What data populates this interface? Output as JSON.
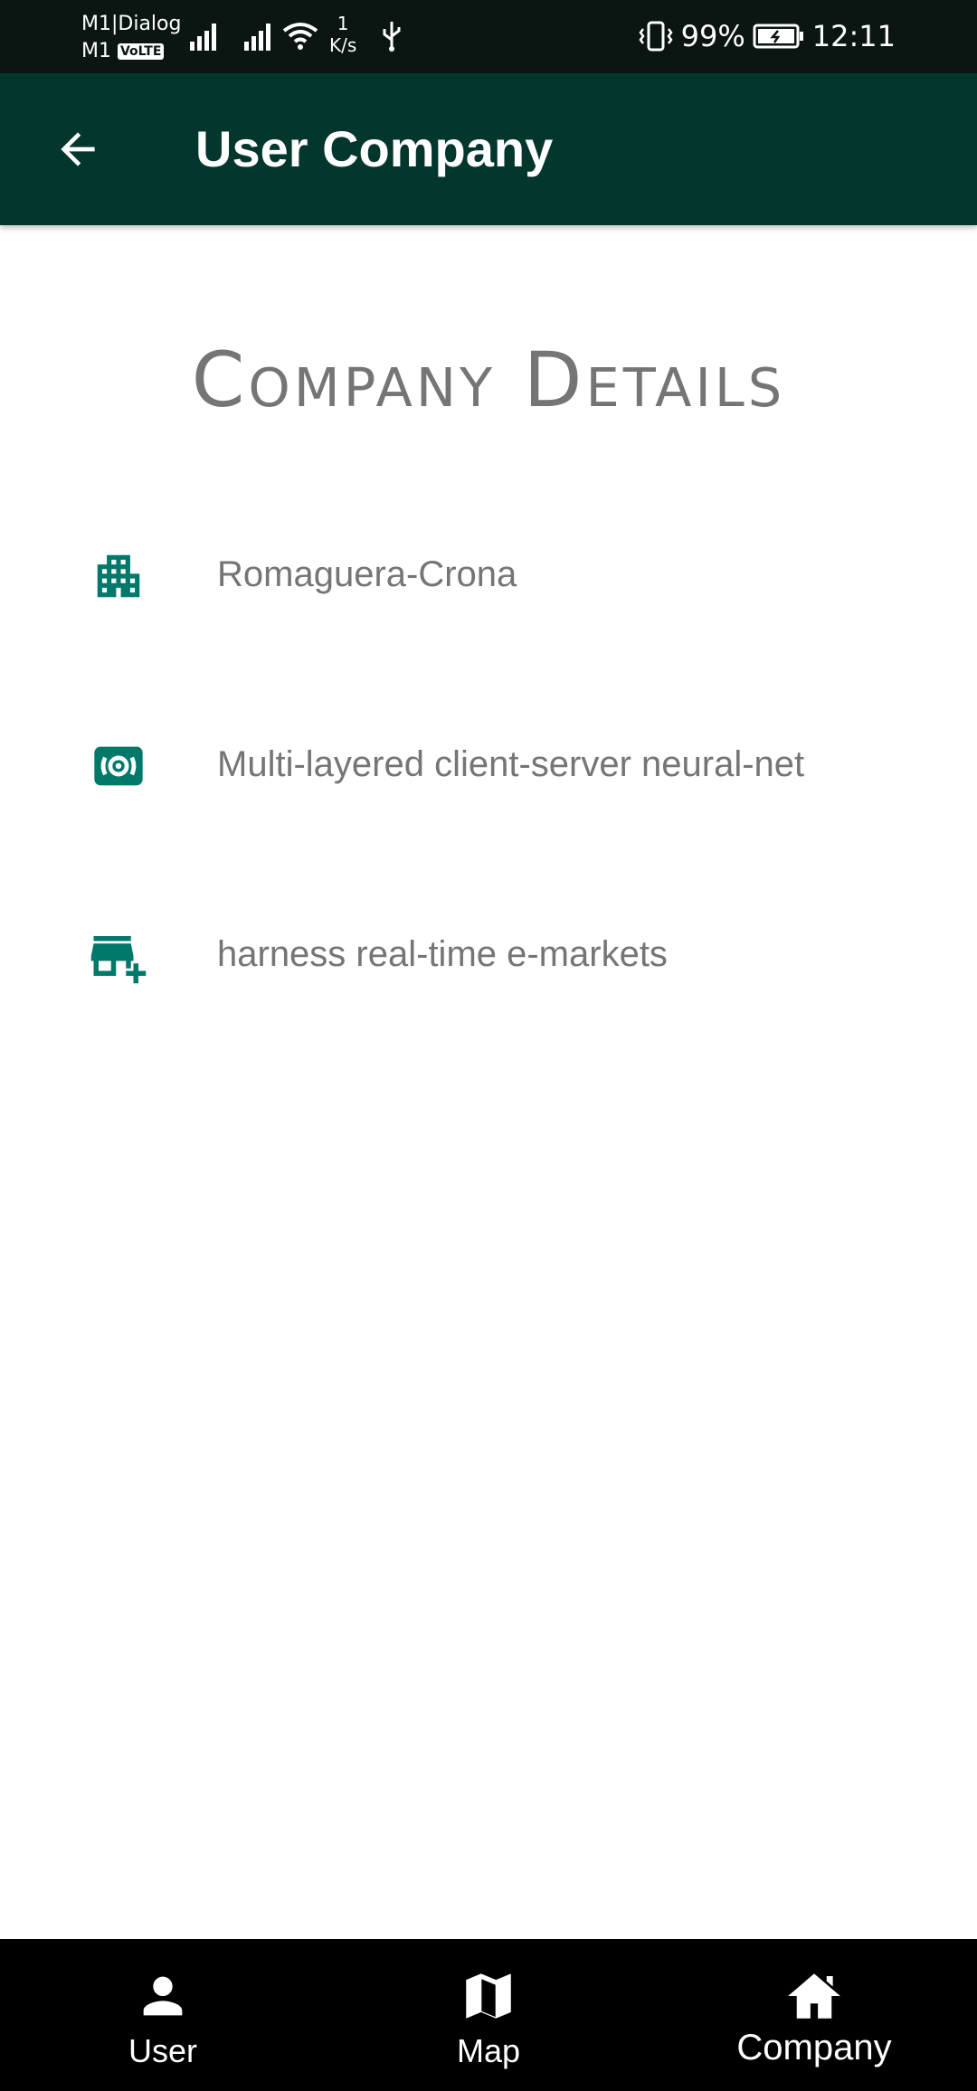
{
  "status_bar": {
    "carrier_top": "M1|Dialog",
    "carrier_bottom": "M1",
    "volte": "VoLTE",
    "net_speed_value": "1",
    "net_speed_unit": "K/s",
    "battery": "99%",
    "time": "12:11"
  },
  "app_bar": {
    "title": "User Company",
    "back_icon": "arrow-back-icon"
  },
  "section": {
    "title": "Company Details"
  },
  "details": [
    {
      "icon": "apartment-icon",
      "text": "Romaguera-Crona"
    },
    {
      "icon": "radio-broadcast-icon",
      "text": "Multi-layered client-server neural-net"
    },
    {
      "icon": "add-business-icon",
      "text": "harness real-time e-markets"
    }
  ],
  "bottom_nav": [
    {
      "icon": "person-icon",
      "label": "User",
      "active": false
    },
    {
      "icon": "map-icon",
      "label": "Map",
      "active": false
    },
    {
      "icon": "home-icon",
      "label": "Company",
      "active": true
    }
  ],
  "colors": {
    "status_bar_bg": "#0b1512",
    "app_bar_bg": "#03362c",
    "icon_teal": "#00796b",
    "text_gray": "#757575",
    "nav_bg": "#000000"
  }
}
